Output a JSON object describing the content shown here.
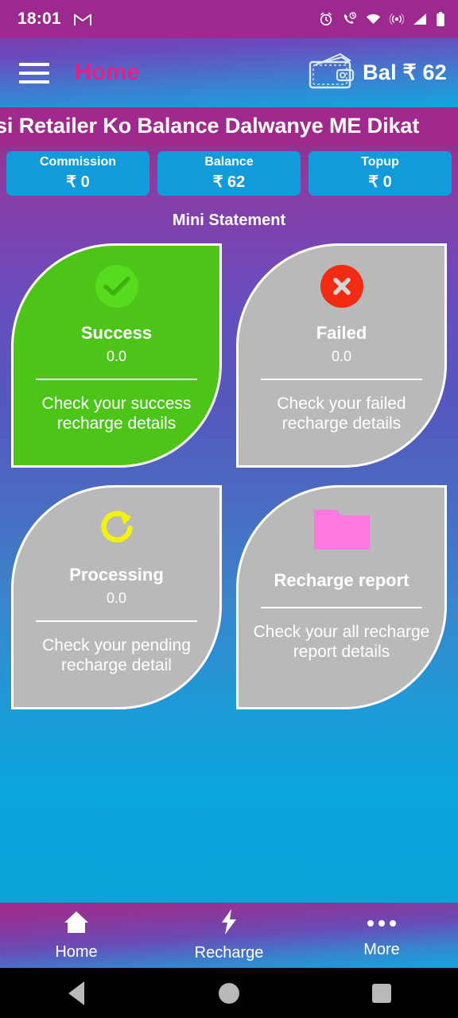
{
  "status_bar": {
    "time": "18:01",
    "icons": [
      "gmail-icon",
      "alarm-icon",
      "call-clock-icon",
      "wifi-icon",
      "hotspot-icon",
      "signal-icon",
      "battery-icon"
    ],
    "background_color": "#9C2A8E"
  },
  "header": {
    "menu_icon": "hamburger-menu-icon",
    "title": "Home",
    "title_color": "#E0218A",
    "wallet_icon": "wallet-icon",
    "balance_label": "Bal ₹ 62"
  },
  "marquee": {
    "text": "si Retailer Ko Balance Dalwanye ME Dikat",
    "background_color": "#A0298E"
  },
  "stats": [
    {
      "label": "Commission",
      "value": "₹ 0"
    },
    {
      "label": "Balance",
      "value": "₹ 62"
    },
    {
      "label": "Topup",
      "value": "₹ 0"
    }
  ],
  "mini_statement": {
    "title": "Mini Statement",
    "cards": [
      {
        "title": "Success",
        "value": "0.0",
        "description": "Check your success recharge details",
        "icon": "check-circle-icon",
        "card_color": "#4CC518",
        "icon_color": "#57DB1E"
      },
      {
        "title": "Failed",
        "value": "0.0",
        "description": "Check your failed recharge details",
        "icon": "error-circle-icon",
        "card_color": "#B9B9B9",
        "icon_color": "#F22C12"
      },
      {
        "title": "Processing",
        "value": "0.0",
        "description": "Check your pending recharge detail",
        "icon": "refresh-icon",
        "card_color": "#B9B9B9",
        "icon_color": "#F2F20D"
      },
      {
        "title": "Recharge report",
        "value": "",
        "description": "Check your all recharge report details",
        "icon": "folder-icon",
        "card_color": "#B9B9B9",
        "icon_color": "#FF77E0"
      }
    ]
  },
  "bottom_nav": [
    {
      "label": "Home",
      "icon": "home-icon"
    },
    {
      "label": "Recharge",
      "icon": "lightning-bolt-icon"
    },
    {
      "label": "More",
      "icon": "more-dots-icon"
    }
  ],
  "system_nav": [
    {
      "icon": "back-triangle-icon"
    },
    {
      "icon": "home-circle-icon"
    },
    {
      "icon": "recents-square-icon"
    }
  ]
}
